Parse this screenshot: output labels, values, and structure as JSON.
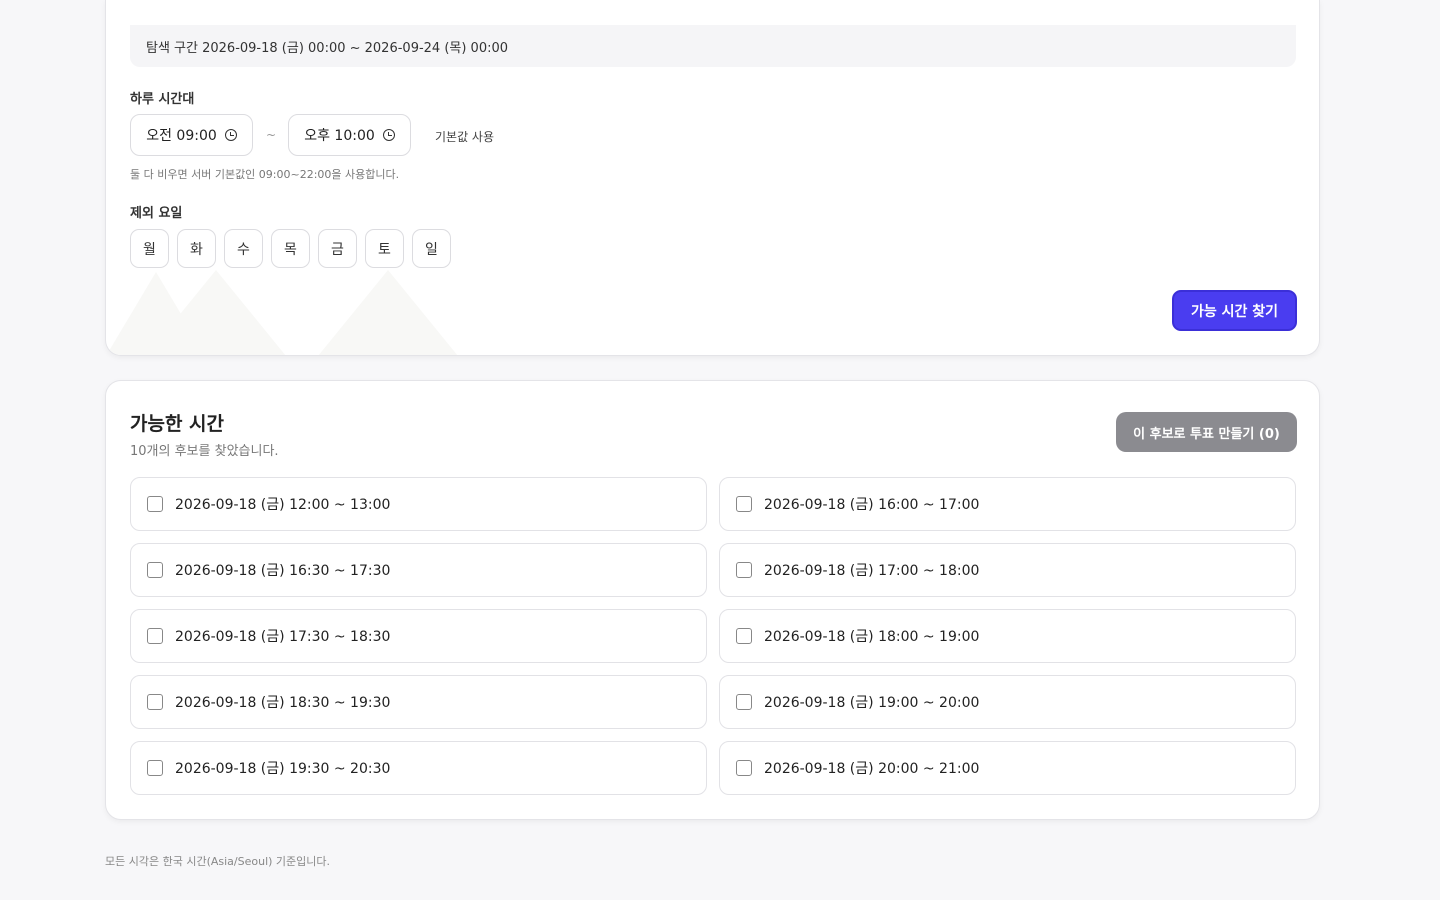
{
  "search": {
    "range_text": "탐색 구간 2026-09-18 (금) 00:00 ~ 2026-09-24 (목) 00:00",
    "daily_label": "하루 시간대",
    "start_time": "오전 09:00",
    "end_time": "오후 10:00",
    "separator": "~",
    "default_link": "기본값 사용",
    "hint": "둘 다 비우면 서버 기본값인 09:00~22:00을 사용합니다.",
    "exclude_label": "제외 요일",
    "days": [
      "월",
      "화",
      "수",
      "목",
      "금",
      "토",
      "일"
    ],
    "search_button": "가능 시간 찾기"
  },
  "results": {
    "title": "가능한 시간",
    "subtitle": "10개의 후보를 찾았습니다.",
    "poll_button": "이 후보로 투표 만들기 (0)",
    "slots": [
      "2026-09-18 (금) 12:00 ~ 13:00",
      "2026-09-18 (금) 16:00 ~ 17:00",
      "2026-09-18 (금) 16:30 ~ 17:30",
      "2026-09-18 (금) 17:00 ~ 18:00",
      "2026-09-18 (금) 17:30 ~ 18:30",
      "2026-09-18 (금) 18:00 ~ 19:00",
      "2026-09-18 (금) 18:30 ~ 19:30",
      "2026-09-18 (금) 19:00 ~ 20:00",
      "2026-09-18 (금) 19:30 ~ 20:30",
      "2026-09-18 (금) 20:00 ~ 21:00"
    ]
  },
  "footer": {
    "note": "모든 시각은 한국 시간(Asia/Seoul) 기준입니다."
  },
  "colors": {
    "accent": "#4a3df0",
    "disabled_button": "#8b8b90"
  }
}
